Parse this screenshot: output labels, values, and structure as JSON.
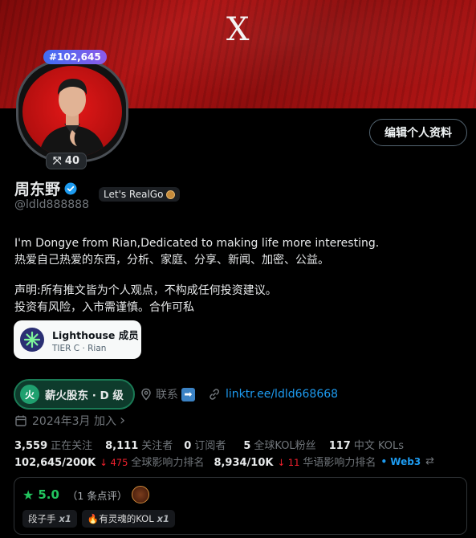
{
  "banner": {
    "logo_text": "X"
  },
  "avatar": {
    "rank_badge": "#102,645",
    "score_badge": "⤧ 40"
  },
  "profile": {
    "edit_button": "编辑个人资料",
    "name": "周东野",
    "tag": "Let's RealGo",
    "handle": "@ldld888888",
    "bio_line1": "I'm Dongye from Rian,Dedicated to making life more interesting.",
    "bio_line2": "热爱自己热爱的东西，分析、家庭、分享、新闻、加密、公益。",
    "bio_line3": "声明:所有推文皆为个人观点，不构成任何投资建议。",
    "bio_line4": "投资有风险，入市需谨慎。合作可私"
  },
  "lighthouse": {
    "title": "Lighthouse 成员",
    "subtitle": "TIER C · Rian"
  },
  "org": {
    "icon_char": "火",
    "label": "薪火股东 · D 级"
  },
  "contact": {
    "label": "联系",
    "arrow": "➡"
  },
  "link": {
    "text": "linktr.ee/ldld668668"
  },
  "joined": {
    "text": "2024年3月 加入",
    "chevron": "›"
  },
  "stats": {
    "following": {
      "num": "3,559",
      "label": "正在关注"
    },
    "followers": {
      "num": "8,111",
      "label": "关注者"
    },
    "subscribers": {
      "num": "0",
      "label": "订阅者"
    },
    "kol_fans": {
      "num": "5",
      "label": "全球KOL粉丝"
    },
    "cn_kols": {
      "num": "117",
      "label": "中文 KOLs"
    },
    "global_rank": {
      "num": "102,645/200K",
      "change": "↓ 475",
      "label": "全球影响力排名"
    },
    "cn_rank": {
      "num": "8,934/10K",
      "change": "↓ 11",
      "label": "华语影响力排名"
    },
    "web3": "• Web3",
    "swap_icon": "⇄"
  },
  "reviews": {
    "star": "★",
    "rating": "5.0",
    "count": "（1 条点评）",
    "chip1": {
      "label": "段子手",
      "mult": "x1"
    },
    "chip2": {
      "label": "🔥有灵魂的KOL",
      "mult": "x1"
    }
  },
  "colors": {
    "accent": "#1d9bf0",
    "green": "#22c55e",
    "red": "#f4212e",
    "banner": "#b11414"
  }
}
